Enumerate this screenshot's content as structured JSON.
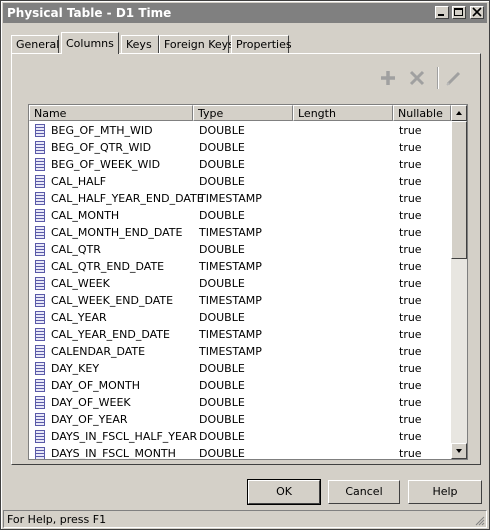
{
  "window": {
    "title": "Physical Table - D1 Time"
  },
  "tabs": [
    {
      "label": "General"
    },
    {
      "label": "Columns"
    },
    {
      "label": "Keys"
    },
    {
      "label": "Foreign Keys"
    },
    {
      "label": "Properties"
    }
  ],
  "toolbar": {
    "icons": [
      "add-icon",
      "delete-icon",
      "edit-icon"
    ]
  },
  "table": {
    "headers": {
      "name": "Name",
      "type": "Type",
      "length": "Length",
      "nullable": "Nullable"
    },
    "rows": [
      {
        "name": "BEG_OF_MTH_WID",
        "type": "DOUBLE",
        "length": "",
        "nullable": "true"
      },
      {
        "name": "BEG_OF_QTR_WID",
        "type": "DOUBLE",
        "length": "",
        "nullable": "true"
      },
      {
        "name": "BEG_OF_WEEK_WID",
        "type": "DOUBLE",
        "length": "",
        "nullable": "true"
      },
      {
        "name": "CAL_HALF",
        "type": "DOUBLE",
        "length": "",
        "nullable": "true"
      },
      {
        "name": "CAL_HALF_YEAR_END_DATE",
        "type": "TIMESTAMP",
        "length": "",
        "nullable": "true"
      },
      {
        "name": "CAL_MONTH",
        "type": "DOUBLE",
        "length": "",
        "nullable": "true"
      },
      {
        "name": "CAL_MONTH_END_DATE",
        "type": "TIMESTAMP",
        "length": "",
        "nullable": "true"
      },
      {
        "name": "CAL_QTR",
        "type": "DOUBLE",
        "length": "",
        "nullable": "true"
      },
      {
        "name": "CAL_QTR_END_DATE",
        "type": "TIMESTAMP",
        "length": "",
        "nullable": "true"
      },
      {
        "name": "CAL_WEEK",
        "type": "DOUBLE",
        "length": "",
        "nullable": "true"
      },
      {
        "name": "CAL_WEEK_END_DATE",
        "type": "TIMESTAMP",
        "length": "",
        "nullable": "true"
      },
      {
        "name": "CAL_YEAR",
        "type": "DOUBLE",
        "length": "",
        "nullable": "true"
      },
      {
        "name": "CAL_YEAR_END_DATE",
        "type": "TIMESTAMP",
        "length": "",
        "nullable": "true"
      },
      {
        "name": "CALENDAR_DATE",
        "type": "TIMESTAMP",
        "length": "",
        "nullable": "true"
      },
      {
        "name": "DAY_KEY",
        "type": "DOUBLE",
        "length": "",
        "nullable": "true"
      },
      {
        "name": "DAY_OF_MONTH",
        "type": "DOUBLE",
        "length": "",
        "nullable": "true"
      },
      {
        "name": "DAY_OF_WEEK",
        "type": "DOUBLE",
        "length": "",
        "nullable": "true"
      },
      {
        "name": "DAY_OF_YEAR",
        "type": "DOUBLE",
        "length": "",
        "nullable": "true"
      },
      {
        "name": "DAYS_IN_FSCL_HALF_YEAR",
        "type": "DOUBLE",
        "length": "",
        "nullable": "true"
      },
      {
        "name": "DAYS_IN_FSCL_MONTH",
        "type": "DOUBLE",
        "length": "",
        "nullable": "true"
      }
    ]
  },
  "buttons": {
    "ok": "OK",
    "cancel": "Cancel",
    "help": "Help"
  },
  "status": {
    "text": "For Help, press F1"
  },
  "colors": {
    "title_bar": "#808080",
    "dialog_bg": "#d4d0c8",
    "column_icon": "#5a5aa8"
  }
}
